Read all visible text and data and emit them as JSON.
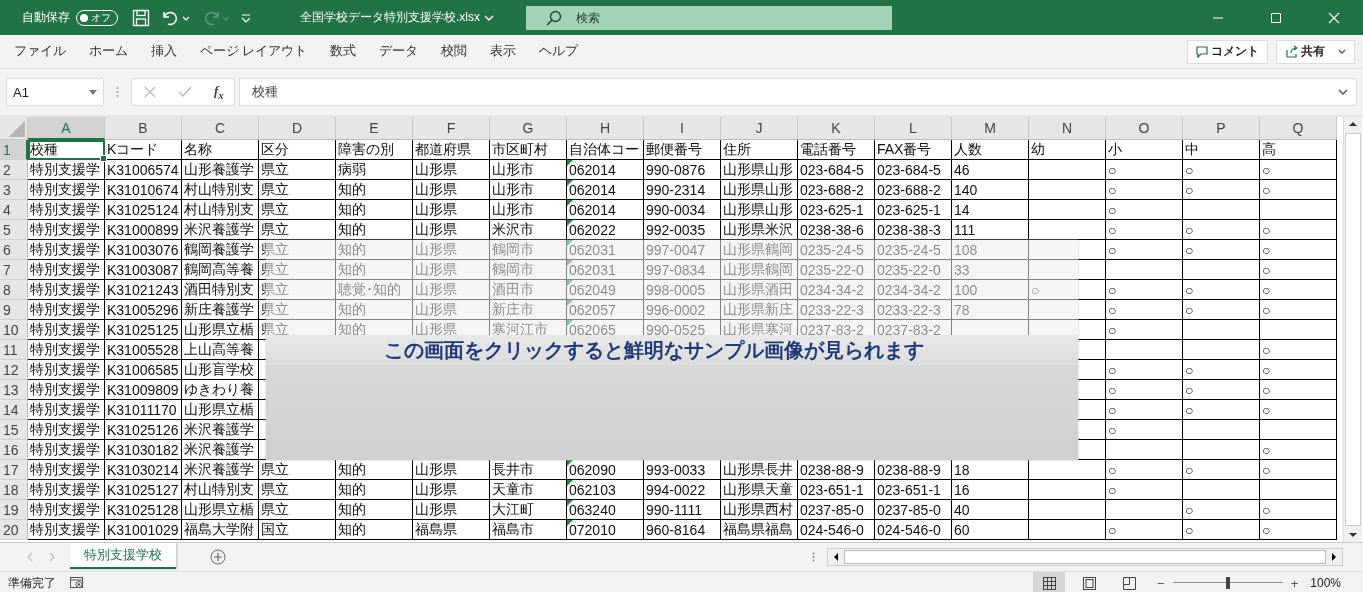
{
  "title_bar": {
    "autosave_label": "自動保存",
    "autosave_toggle": {
      "label": "オフ",
      "on": false
    },
    "quick_access": [
      {
        "kind": "save",
        "disabled": false
      },
      {
        "kind": "undo",
        "disabled": false
      },
      {
        "kind": "redo",
        "disabled": true
      },
      {
        "kind": "customize",
        "disabled": false
      }
    ],
    "file_name": "全国学校データ特別支援学校.xlsx",
    "search": {
      "placeholder": "検索"
    }
  },
  "ribbon": {
    "tabs": [
      {
        "label": "ファイル",
        "selected": false
      },
      {
        "label": "ホーム",
        "selected": false
      },
      {
        "label": "挿入",
        "selected": false
      },
      {
        "label": "ページ レイアウト",
        "selected": false
      },
      {
        "label": "数式",
        "selected": false
      },
      {
        "label": "データ",
        "selected": false
      },
      {
        "label": "校閲",
        "selected": false
      },
      {
        "label": "表示",
        "selected": false
      },
      {
        "label": "ヘルプ",
        "selected": false
      }
    ],
    "comment_button": "コメント",
    "share_button": "共有"
  },
  "formula_bar": {
    "name_box": "A1",
    "function_label": "f$_{x}$",
    "formula": "校種"
  },
  "sheet": {
    "columns": [
      {
        "letter": "A",
        "selected": true,
        "warning_marks": false
      },
      {
        "letter": "B",
        "selected": false,
        "warning_marks": false
      },
      {
        "letter": "C",
        "selected": false,
        "warning_marks": false
      },
      {
        "letter": "D",
        "selected": false,
        "warning_marks": false
      },
      {
        "letter": "E",
        "selected": false,
        "warning_marks": false
      },
      {
        "letter": "F",
        "selected": false,
        "warning_marks": false
      },
      {
        "letter": "G",
        "selected": false,
        "warning_marks": false
      },
      {
        "letter": "H",
        "selected": false,
        "warning_marks": true
      },
      {
        "letter": "I",
        "selected": false,
        "warning_marks": false
      },
      {
        "letter": "J",
        "selected": false,
        "warning_marks": false
      },
      {
        "letter": "K",
        "selected": false,
        "warning_marks": false
      },
      {
        "letter": "L",
        "selected": false,
        "warning_marks": false
      },
      {
        "letter": "M",
        "selected": false,
        "warning_marks": false
      },
      {
        "letter": "N",
        "selected": false,
        "warning_marks": false
      },
      {
        "letter": "O",
        "selected": false,
        "warning_marks": false
      },
      {
        "letter": "P",
        "selected": false,
        "warning_marks": false
      },
      {
        "letter": "Q",
        "selected": false,
        "warning_marks": false
      }
    ],
    "rows": [
      {
        "number": "1",
        "selected": true,
        "cells": [
          "校種",
          "Kコード",
          "名称",
          "区分",
          "障害の別",
          "都道府県",
          "市区町村",
          "自治体コー",
          "郵便番号",
          "住所",
          "電話番号",
          "FAX番号",
          "人数",
          "幼",
          "小",
          "中",
          "高"
        ]
      },
      {
        "number": "2",
        "selected": false,
        "cells": [
          "特別支援学",
          "K31006574",
          "山形養護学",
          "県立",
          "病弱",
          "山形県",
          "山形市",
          "062014",
          "990-0876",
          "山形県山形",
          "023-684-5",
          "023-684-5",
          "46",
          null,
          "○",
          "○",
          "○"
        ]
      },
      {
        "number": "3",
        "selected": false,
        "cells": [
          "特別支援学",
          "K31010674",
          "村山特別支",
          "県立",
          "知的",
          "山形県",
          "山形市",
          "062014",
          "990-2314",
          "山形県山形",
          "023-688-2",
          "023-688-2",
          "140",
          null,
          "○",
          "○",
          "○"
        ]
      },
      {
        "number": "4",
        "selected": false,
        "cells": [
          "特別支援学",
          "K31025124",
          "村山特別支",
          "県立",
          "知的",
          "山形県",
          "山形市",
          "062014",
          "990-0034",
          "山形県山形",
          "023-625-1",
          "023-625-1",
          "14",
          null,
          "○",
          null,
          null
        ]
      },
      {
        "number": "5",
        "selected": false,
        "cells": [
          "特別支援学",
          "K31000899",
          "米沢養護学",
          "県立",
          "知的",
          "山形県",
          "米沢市",
          "062022",
          "992-0035",
          "山形県米沢",
          "0238-38-6",
          "0238-38-3",
          "111",
          null,
          "○",
          "○",
          "○"
        ]
      },
      {
        "number": "6",
        "selected": false,
        "cells": [
          "特別支援学",
          "K31003076",
          "鶴岡養護学",
          "県立",
          "知的",
          "山形県",
          "鶴岡市",
          "062031",
          "997-0047",
          "山形県鶴岡",
          "0235-24-5",
          "0235-24-5",
          "108",
          null,
          "○",
          "○",
          "○"
        ]
      },
      {
        "number": "7",
        "selected": false,
        "cells": [
          "特別支援学",
          "K31003087",
          "鶴岡高等養",
          "県立",
          "知的",
          "山形県",
          "鶴岡市",
          "062031",
          "997-0834",
          "山形県鶴岡",
          "0235-22-0",
          "0235-22-0",
          "33",
          null,
          null,
          null,
          "○"
        ]
      },
      {
        "number": "8",
        "selected": false,
        "cells": [
          "特別支援学",
          "K31021243",
          "酒田特別支",
          "県立",
          "聴覚･知的",
          "山形県",
          "酒田市",
          "062049",
          "998-0005",
          "山形県酒田",
          "0234-34-2",
          "0234-34-2",
          "100",
          "○",
          "○",
          "○",
          "○"
        ]
      },
      {
        "number": "9",
        "selected": false,
        "cells": [
          "特別支援学",
          "K31005296",
          "新庄養護学",
          "県立",
          "知的",
          "山形県",
          "新庄市",
          "062057",
          "996-0002",
          "山形県新庄",
          "0233-22-3",
          "0233-22-3",
          "78",
          null,
          "○",
          "○",
          "○"
        ]
      },
      {
        "number": "10",
        "selected": false,
        "cells": [
          "特別支援学",
          "K31025125",
          "山形県立楯",
          "県立",
          "知的",
          "山形県",
          "寒河江市",
          "062065",
          "990-0525",
          "山形県寒河",
          "0237-83-2",
          "0237-83-2",
          null,
          null,
          "○",
          null,
          null
        ]
      },
      {
        "number": "11",
        "selected": false,
        "cells": [
          "特別支援学",
          "K31005528",
          "上山高等養",
          null,
          null,
          null,
          null,
          null,
          null,
          null,
          null,
          null,
          null,
          null,
          null,
          null,
          "○"
        ]
      },
      {
        "number": "12",
        "selected": false,
        "cells": [
          "特別支援学",
          "K31006585",
          "山形盲学校",
          null,
          null,
          null,
          null,
          null,
          null,
          null,
          null,
          null,
          null,
          null,
          "○",
          "○",
          "○"
        ]
      },
      {
        "number": "13",
        "selected": false,
        "cells": [
          "特別支援学",
          "K31009809",
          "ゆきわり養",
          null,
          null,
          null,
          null,
          null,
          null,
          null,
          null,
          null,
          null,
          null,
          "○",
          "○",
          "○"
        ]
      },
      {
        "number": "14",
        "selected": false,
        "cells": [
          "特別支援学",
          "K31011170",
          "山形県立楯",
          null,
          null,
          null,
          null,
          null,
          null,
          null,
          null,
          null,
          null,
          null,
          "○",
          "○",
          "○"
        ]
      },
      {
        "number": "15",
        "selected": false,
        "cells": [
          "特別支援学",
          "K31025126",
          "米沢養護学",
          null,
          null,
          null,
          null,
          null,
          null,
          null,
          null,
          null,
          null,
          null,
          "○",
          null,
          null
        ]
      },
      {
        "number": "16",
        "selected": false,
        "cells": [
          "特別支援学",
          "K31030182",
          "米沢養護学",
          null,
          null,
          null,
          null,
          null,
          null,
          null,
          null,
          null,
          null,
          null,
          null,
          null,
          "○"
        ]
      },
      {
        "number": "17",
        "selected": false,
        "cells": [
          "特別支援学",
          "K31030214",
          "米沢養護学",
          "県立",
          "知的",
          "山形県",
          "長井市",
          "062090",
          "993-0033",
          "山形県長井",
          "0238-88-9",
          "0238-88-9",
          "18",
          null,
          "○",
          "○",
          "○"
        ]
      },
      {
        "number": "18",
        "selected": false,
        "cells": [
          "特別支援学",
          "K31025127",
          "村山特別支",
          "県立",
          "知的",
          "山形県",
          "天童市",
          "062103",
          "994-0022",
          "山形県天童",
          "023-651-1",
          "023-651-1",
          "16",
          null,
          "○",
          null,
          null
        ]
      },
      {
        "number": "19",
        "selected": false,
        "cells": [
          "特別支援学",
          "K31025128",
          "山形県立楯",
          "県立",
          "知的",
          "山形県",
          "大江町",
          "063240",
          "990-1111",
          "山形県西村",
          "0237-85-0",
          "0237-85-0",
          "40",
          null,
          null,
          "○",
          "○"
        ]
      },
      {
        "number": "20",
        "selected": false,
        "cells": [
          "特別支援学",
          "K31001029",
          "福島大学附",
          "国立",
          "知的",
          "福島県",
          "福島市",
          "072010",
          "960-8164",
          "福島県福島",
          "024-546-0",
          "024-546-0",
          "60",
          null,
          "○",
          "○",
          "○"
        ]
      }
    ]
  },
  "overlay": {
    "message": "この画面をクリックすると鮮明なサンプル画像が見られます"
  },
  "sheet_tabs": [
    {
      "label": "特別支援学校",
      "selected": true
    }
  ],
  "status_bar": {
    "status": "準備完了",
    "view_buttons": [
      {
        "kind": "normal",
        "selected": true
      },
      {
        "kind": "page_layout",
        "selected": false
      },
      {
        "kind": "page_break",
        "selected": false
      }
    ],
    "zoom": {
      "minus": "−",
      "plus": "+",
      "level": 0.5,
      "reading": "100%"
    }
  }
}
